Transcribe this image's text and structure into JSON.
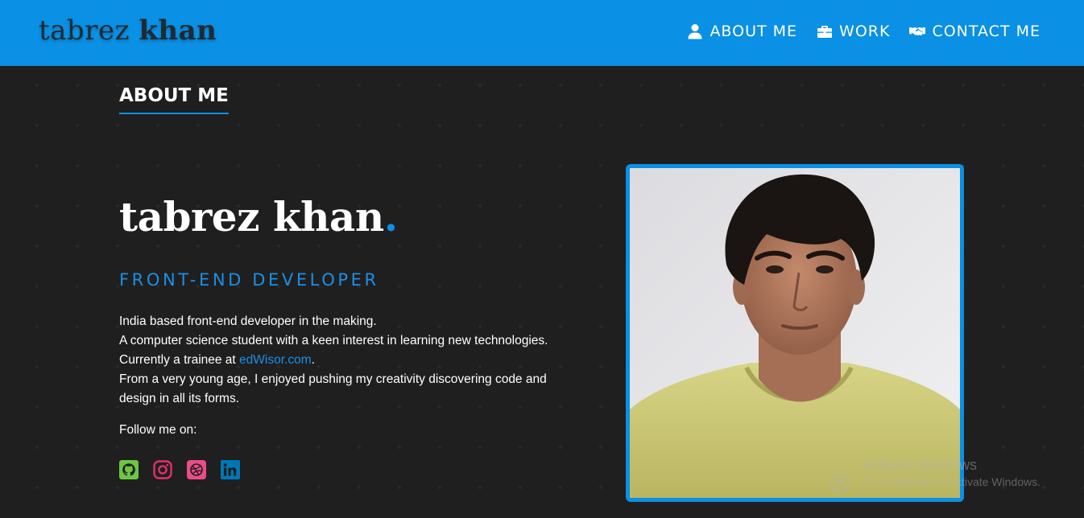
{
  "header": {
    "brand_first": "tabrez",
    "brand_last": "khan",
    "nav": [
      {
        "label": "ABOUT ME",
        "icon": "user-icon"
      },
      {
        "label": "WORK",
        "icon": "briefcase-icon"
      },
      {
        "label": "CONTACT ME",
        "icon": "handshake-icon"
      }
    ]
  },
  "section": {
    "title": "ABOUT ME"
  },
  "intro": {
    "name_first": "tabrez",
    "name_last": "khan",
    "name_dot": ".",
    "role": "FRONT-END DEVELOPER",
    "bio_line1": "India based front-end developer in the making.",
    "bio_line2": "A computer science student with a keen interest in learning new technologies.",
    "bio_line3_prefix": "Currently a trainee at ",
    "bio_link": "edWisor.com",
    "bio_line3_suffix": ".",
    "bio_line4": "From a very young age, I enjoyed pushing my creativity discovering code and design in all its forms.",
    "follow_label": "Follow me on:",
    "socials": [
      {
        "name": "github-icon",
        "color": "#6cc644"
      },
      {
        "name": "instagram-icon",
        "color": "#e1306c"
      },
      {
        "name": "dribbble-icon",
        "color": "#ea4c89"
      },
      {
        "name": "linkedin-icon",
        "color": "#0077b5"
      }
    ]
  },
  "watermark": {
    "title": "Activate Windows",
    "subtitle": "Go to Settings to activate Windows."
  },
  "colors": {
    "accent": "#0a90e4",
    "background": "#1f1f1f"
  }
}
